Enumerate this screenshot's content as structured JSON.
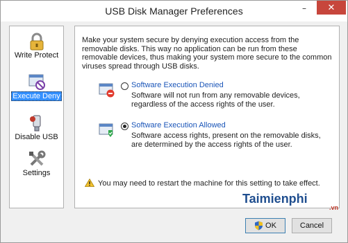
{
  "window": {
    "title": "USB Disk Manager Preferences",
    "minimize_glyph": "–",
    "close_glyph": "✕",
    "close_color": "#c7463c"
  },
  "sidebar": {
    "items": [
      {
        "label": "Write Protect",
        "icon": "lock-icon"
      },
      {
        "label": "Execute Deny",
        "icon": "execute-deny-icon",
        "selected": true
      },
      {
        "label": "Disable USB",
        "icon": "usb-icon"
      },
      {
        "label": "Settings",
        "icon": "tools-icon"
      }
    ],
    "selected_color": "#3390ff"
  },
  "panel": {
    "intro": "Make your system secure by denying execution access from the removable disks. This way no application can be run from these removable devices, thus making your system more secure to the common viruses spread through USB disks.",
    "options": [
      {
        "title": "Software Execution Denied",
        "description": "Software will not run from any removable devices, regardless of the access rights of the user.",
        "selected": false,
        "icon": "window-denied-icon"
      },
      {
        "title": "Software Execution Allowed",
        "description": "Software access rights, present on the removable disks, are determined by the access rights of the user.",
        "selected": true,
        "icon": "window-allowed-icon"
      }
    ],
    "warning": "You may need to restart the machine for this setting to take effect.",
    "warning_icon": "warning-icon"
  },
  "buttons": {
    "ok_label": "OK",
    "cancel_label": "Cancel",
    "ok_icon": "shield-icon"
  },
  "watermark": {
    "text": "Taimienphi",
    "suffix": ".vn"
  }
}
